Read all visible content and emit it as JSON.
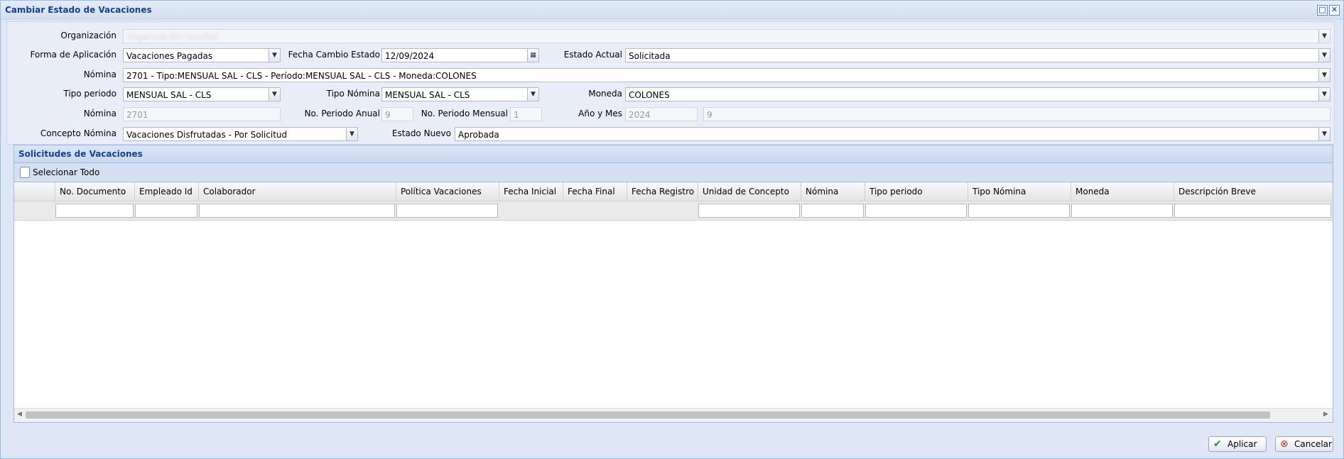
{
  "window": {
    "title": "Cambiar Estado de Vacaciones"
  },
  "form": {
    "organizacion": {
      "label": "Organización",
      "value": "Organización (oculta)"
    },
    "forma_aplicacion": {
      "label": "Forma de Aplicación",
      "value": "Vacaciones Pagadas"
    },
    "fecha_cambio": {
      "label": "Fecha Cambio Estado",
      "value": "12/09/2024"
    },
    "estado_actual": {
      "label": "Estado Actual",
      "value": "Solicitada"
    },
    "nomina": {
      "label": "Nómina",
      "value": "2701 - Tipo:MENSUAL SAL - CLS - Período:MENSUAL SAL - CLS - Moneda:COLONES"
    },
    "tipo_periodo": {
      "label": "Tipo periodo",
      "value": "MENSUAL SAL - CLS"
    },
    "tipo_nomina": {
      "label": "Tipo Nómina",
      "value": "MENSUAL SAL - CLS"
    },
    "moneda": {
      "label": "Moneda",
      "value": "COLONES"
    },
    "nomina_num": {
      "label": "Nómina",
      "value": "2701"
    },
    "periodo_anual": {
      "label": "No. Periodo Anual",
      "value": "9"
    },
    "periodo_mensual": {
      "label": "No. Periodo Mensual",
      "value": "1"
    },
    "anio_mes": {
      "label": "Año y Mes",
      "anio": "2024",
      "mes": "9"
    },
    "concepto_nomina": {
      "label": "Concepto Nómina",
      "value": "Vacaciones Disfrutadas - Por Solicitud"
    },
    "estado_nuevo": {
      "label": "Estado Nuevo",
      "value": "Aprobada"
    }
  },
  "panel": {
    "title": "Solicitudes de Vacaciones",
    "select_all": "Selecionar Todo",
    "columns": [
      "No. Documento",
      "Empleado Id",
      "Colaborador",
      "Política Vacaciones",
      "Fecha Inicial",
      "Fecha Final",
      "Fecha Registro",
      "Unidad de Concepto",
      "Nómina",
      "Tipo periodo",
      "Tipo Nómina",
      "Moneda",
      "Descripción Breve"
    ]
  },
  "buttons": {
    "aplicar": "Aplicar",
    "cancelar": "Cancelar"
  },
  "colors": {
    "title": "#15428b",
    "border": "#99bbe8",
    "background": "#dfe6f5"
  }
}
